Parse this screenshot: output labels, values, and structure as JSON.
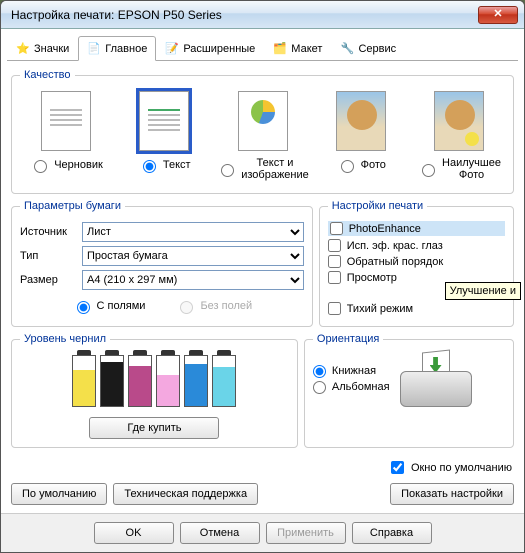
{
  "window": {
    "title": "Настройка печати: EPSON P50 Series",
    "close": "✕"
  },
  "tabs": {
    "t0": "Значки",
    "t1": "Главное",
    "t2": "Расширенные",
    "t3": "Макет",
    "t4": "Сервис"
  },
  "quality": {
    "legend": "Качество",
    "q0": "Черновик",
    "q1": "Текст",
    "q2": "Текст и изображение",
    "q3": "Фото",
    "q4": "Наилучшее Фото"
  },
  "paper": {
    "legend": "Параметры бумаги",
    "src_label": "Источник",
    "src_value": "Лист",
    "type_label": "Тип",
    "type_value": "Простая бумага",
    "size_label": "Размер",
    "size_value": "A4 (210 x 297 мм)",
    "margins_on": "С полями",
    "margins_off": "Без полей"
  },
  "print": {
    "legend": "Настройки печати",
    "pe": "PhotoEnhance",
    "redeye": "Исп. эф. крас. глаз",
    "reverse": "Обратный порядок",
    "preview": "Просмотр",
    "quiet": "Тихий режим",
    "tooltip": "Улучшение и"
  },
  "ink": {
    "legend": "Уровень чернил",
    "buy": "Где купить",
    "levels": {
      "c0": {
        "color": "#f4e04a",
        "h": "72%"
      },
      "c1": {
        "color": "#1a1a1a",
        "h": "88%"
      },
      "c2": {
        "color": "#b94a8a",
        "h": "80%"
      },
      "c3": {
        "color": "#f4a8e0",
        "h": "62%"
      },
      "c4": {
        "color": "#2a8ad9",
        "h": "84%"
      },
      "c5": {
        "color": "#6ad4e8",
        "h": "78%"
      }
    }
  },
  "orient": {
    "legend": "Ориентация",
    "portrait": "Книжная",
    "landscape": "Альбомная"
  },
  "footer": {
    "default_window": "Окно по умолчанию",
    "defaults": "По умолчанию",
    "support": "Техническая поддержка",
    "show": "Показать настройки"
  },
  "buttons": {
    "ok": "OK",
    "cancel": "Отмена",
    "apply": "Применить",
    "help": "Справка"
  }
}
